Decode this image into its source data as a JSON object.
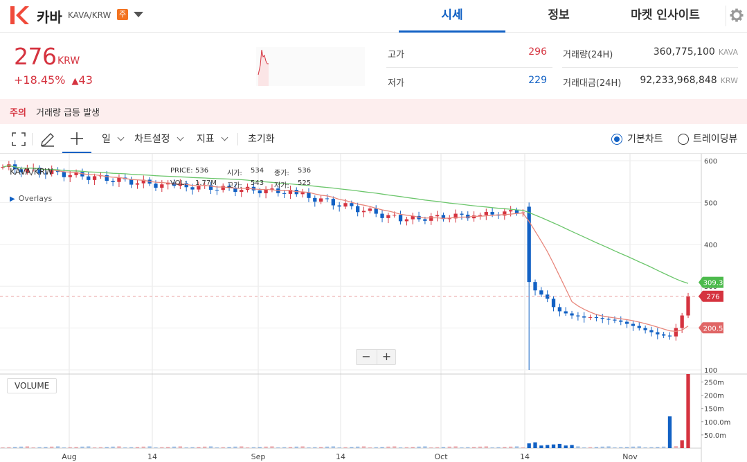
{
  "header": {
    "coin_name": "카바",
    "pair": "KAVA/KRW",
    "badge": "주",
    "tabs": [
      {
        "label": "시세",
        "active": true
      },
      {
        "label": "정보",
        "active": false
      },
      {
        "label": "마켓 인사이트",
        "active": false
      }
    ]
  },
  "price": {
    "current": "276",
    "unit": "KRW",
    "change_pct": "+18.45%",
    "change_arrow": "▲",
    "change_amt": "43"
  },
  "stats": {
    "high_label": "고가",
    "high_value": "296",
    "low_label": "저가",
    "low_value": "229",
    "volume_label": "거래량(24H)",
    "volume_value": "360,775,100",
    "volume_unit": "KAVA",
    "amount_label": "거래대금(24H)",
    "amount_value": "92,233,968,848",
    "amount_unit": "KRW"
  },
  "notice": {
    "tag": "주의",
    "text": "거래량 급등 발생"
  },
  "toolbar": {
    "period": "일",
    "chart_settings": "차트설정",
    "indicators": "지표",
    "reset": "초기화",
    "basic_chart": "기본차트",
    "trading_view": "트레이딩뷰"
  },
  "legend": {
    "name": "KAVA/KRW",
    "overlays": "Overlays",
    "price_label": "PRICE:",
    "price_value": "536",
    "open_label": "시가:",
    "open_value": "534",
    "close_label": "종가:",
    "close_value": "536",
    "vol_label": "VOL:",
    "vol_value": "1.77M",
    "high_label": "고가:",
    "high_value": "543",
    "low_label": "저가:",
    "low_value": "525"
  },
  "colors": {
    "up": "#d5333f",
    "down": "#1261c4",
    "ma_short": "#e8877c",
    "ma_long": "#6cc66c"
  },
  "chart_data": {
    "type": "candlestick",
    "y_ticks": [
      "600",
      "500",
      "400",
      "300",
      "200",
      "100"
    ],
    "x_ticks": [
      "Aug",
      "14",
      "Sep",
      "14",
      "Oct",
      "14",
      "Nov"
    ],
    "price_tags": [
      {
        "label": "309.3",
        "value": 309.3,
        "color": "#4cba4c"
      },
      {
        "label": "276",
        "value": 276,
        "color": "#d5333f"
      },
      {
        "label": "200.5",
        "value": 200.5,
        "color": "#e06666"
      }
    ],
    "volume_ticks": [
      "250m",
      "200m",
      "150m",
      "100.0m",
      "50.0m"
    ],
    "volume_label": "VOLUME"
  }
}
